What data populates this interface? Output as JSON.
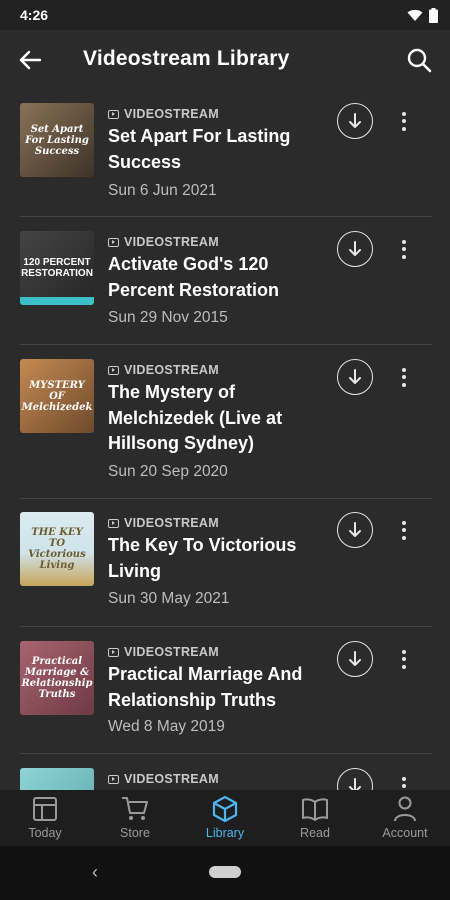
{
  "status": {
    "time": "4:26",
    "wifi_icon": "wifi-icon",
    "battery_icon": "battery-icon"
  },
  "appbar": {
    "title": "Videostream Library",
    "back_icon": "arrow-back-icon",
    "search_icon": "search-icon"
  },
  "items": [
    {
      "category": "VIDEOSTREAM",
      "title": "Set Apart For Lasting Success",
      "date": "Sun 6 Jun 2021",
      "thumb_colors": [
        "#6d5a44",
        "#3d3228"
      ],
      "thumb_text": "Set Apart For Lasting Success"
    },
    {
      "category": "VIDEOSTREAM",
      "title": "Activate God's 120 Percent Restoration",
      "date": "Sun 29 Nov 2015",
      "thumb_colors": [
        "#3a3a3a",
        "#262626"
      ],
      "thumb_text": "120 PERCENT RESTORATION",
      "band_color": "#3cc0c8"
    },
    {
      "category": "VIDEOSTREAM",
      "title": "The Mystery of Melchizedek (Live at Hillsong Sydney)",
      "date": "Sun 20 Sep 2020",
      "thumb_colors": [
        "#b27a46",
        "#6f4a2b"
      ],
      "thumb_text": "MYSTERY OF Melchizedek"
    },
    {
      "category": "VIDEOSTREAM",
      "title": "The Key To Victorious Living",
      "date": "Sun 30 May 2021",
      "thumb_colors": [
        "#cfe3ea",
        "#c8a45a"
      ],
      "thumb_text": "THE KEY TO Victorious Living"
    },
    {
      "category": "VIDEOSTREAM",
      "title": "Practical Marriage And Relationship Truths",
      "date": "Wed 8 May 2019",
      "thumb_colors": [
        "#9c5660",
        "#6e3a44"
      ],
      "thumb_text": "Practical Marriage & Relationship Truths"
    },
    {
      "category": "VIDEOSTREAM",
      "title": "",
      "date": "",
      "thumb_colors": [
        "#7fc7c9",
        "#5aa9ad"
      ],
      "thumb_text": ""
    }
  ],
  "item_icons": {
    "download": "download-icon",
    "more": "more-vert-icon",
    "category": "video-icon"
  },
  "nav": [
    {
      "label": "Today",
      "icon": "today-icon",
      "active": false
    },
    {
      "label": "Store",
      "icon": "cart-icon",
      "active": false
    },
    {
      "label": "Library",
      "icon": "box-icon",
      "active": true
    },
    {
      "label": "Read",
      "icon": "book-icon",
      "active": false
    },
    {
      "label": "Account",
      "icon": "account-icon",
      "active": false
    }
  ],
  "colors": {
    "background": "#2b2b2b",
    "accent": "#4fb5f0",
    "nav_background": "#1e1e1e"
  }
}
